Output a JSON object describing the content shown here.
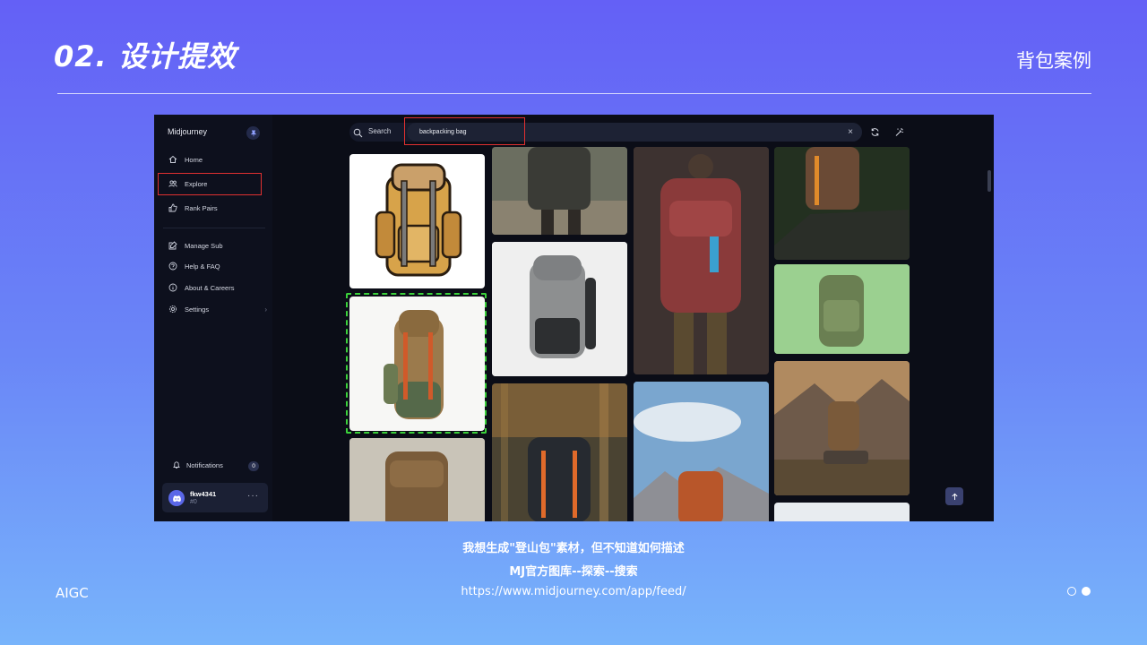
{
  "slide": {
    "title": "02. 设计提效",
    "subtitle": "背包案例",
    "footer_tag": "AIGC",
    "caption_line1": "我想生成\"登山包\"素材，但不知道如何描述",
    "caption_line2": "MJ官方图库--探索--搜索",
    "url": "https://www.midjourney.com/app/feed/",
    "page_dots": [
      "inactive",
      "active"
    ]
  },
  "app": {
    "brand": "Midjourney",
    "nav_primary": [
      {
        "label": "Home",
        "icon": "home-icon"
      },
      {
        "label": "Explore",
        "icon": "explore-icon",
        "selected": true
      },
      {
        "label": "Rank Pairs",
        "icon": "thumbs-up-icon"
      }
    ],
    "nav_secondary": [
      {
        "label": "Manage Sub",
        "icon": "edit-icon"
      },
      {
        "label": "Help & FAQ",
        "icon": "help-icon"
      },
      {
        "label": "About & Careers",
        "icon": "info-icon"
      },
      {
        "label": "Settings",
        "icon": "gear-icon"
      }
    ],
    "notifications": {
      "label": "Notifications",
      "count": "0"
    },
    "user": {
      "name": "fkw4341",
      "tag": "#0"
    },
    "search": {
      "label": "Search",
      "query": "backpacking bag"
    },
    "colors": {
      "annotation_red": "#e03030",
      "annotation_green": "#3bd13b",
      "accent": "#5a67e8"
    }
  }
}
